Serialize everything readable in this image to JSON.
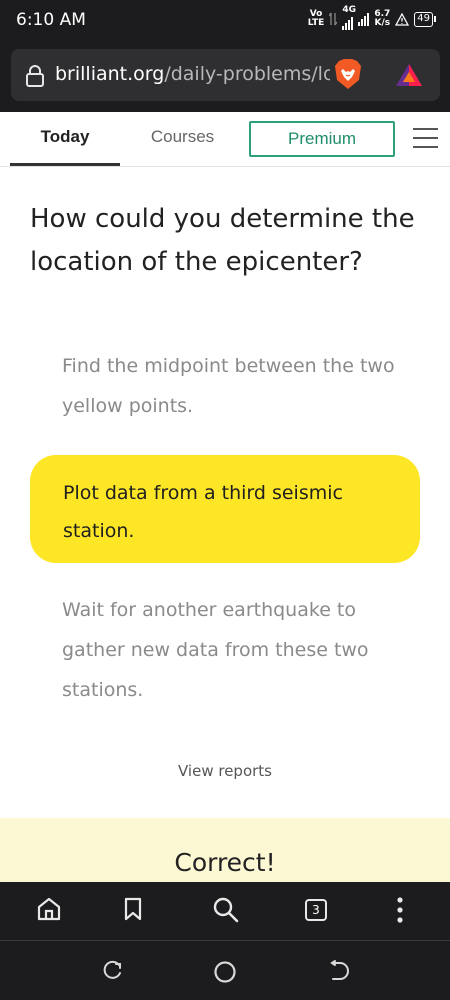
{
  "status_bar": {
    "time": "6:10 AM",
    "volte_top": "Vo",
    "volte_bottom": "LTE",
    "network": "4G",
    "speed_value": "6.7",
    "speed_unit": "K/s",
    "battery": "49"
  },
  "browser": {
    "url_domain": "brilliant.org",
    "url_path": "/daily-problems/lo",
    "tab_count": "3"
  },
  "nav": {
    "today": "Today",
    "courses": "Courses",
    "premium": "Premium"
  },
  "question": "How could you determine the location of the epicenter?",
  "options": [
    {
      "text": "Find the midpoint between the two yellow points.",
      "selected": false
    },
    {
      "text": "Plot data from a third seismic station.",
      "selected": true
    },
    {
      "text": "Wait for another earthquake to gather new data from these two stations.",
      "selected": false
    }
  ],
  "view_reports": "View reports",
  "result": "Correct!",
  "colors": {
    "accent_green": "#2fa07c",
    "selected_yellow": "#fde626",
    "correct_panel": "#fdf8d4",
    "chrome_dark": "#1c1c1e"
  }
}
